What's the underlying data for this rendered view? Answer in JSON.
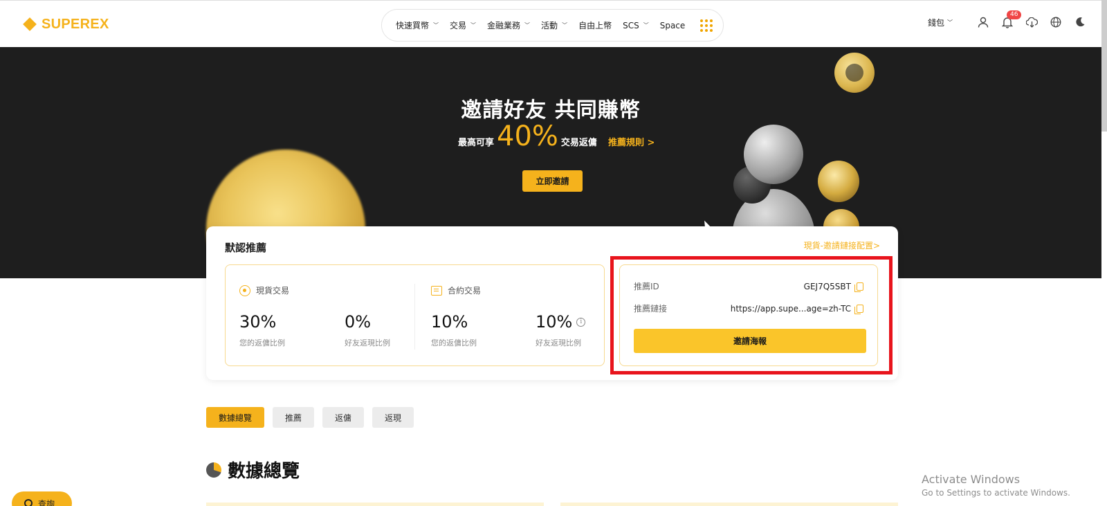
{
  "header": {
    "logo_text": "SUPEREX",
    "nav": [
      {
        "label": "快速買幣",
        "dropdown": true
      },
      {
        "label": "交易",
        "dropdown": true
      },
      {
        "label": "金融業務",
        "dropdown": true
      },
      {
        "label": "活動",
        "dropdown": true
      },
      {
        "label": "自由上幣",
        "dropdown": false
      },
      {
        "label": "SCS",
        "dropdown": true
      },
      {
        "label": "Space",
        "dropdown": false
      }
    ],
    "wallet_label": "錢包",
    "notification_count": "46",
    "icons": [
      "user-icon",
      "bell-icon",
      "download-icon",
      "globe-icon",
      "moon-icon"
    ]
  },
  "hero": {
    "title": "邀請好友 共同賺幣",
    "sub_prefix": "最高可享",
    "sub_percent": "40%",
    "sub_suffix": "交易返傭",
    "rules_link": "推薦規則 >",
    "invite_button": "立即邀請"
  },
  "referral": {
    "title": "默認推薦",
    "config_link": "現貨-邀請鏈接配置>",
    "spot": {
      "label": "現貨交易",
      "your_rate": "30%",
      "your_rate_label": "您的返傭比例",
      "friend_rate": "0%",
      "friend_rate_label": "好友返現比例"
    },
    "futures": {
      "label": "合約交易",
      "your_rate": "10%",
      "your_rate_label": "您的返傭比例",
      "friend_rate": "10%",
      "friend_rate_label": "好友返現比例"
    },
    "id_label": "推薦ID",
    "id_value": "GEJ7Q5SBT",
    "link_label": "推薦鏈接",
    "link_value": "https://app.supe...age=zh-TC",
    "poster_button": "邀請海報"
  },
  "tabs": [
    {
      "label": "數據總覽",
      "active": true
    },
    {
      "label": "推薦",
      "active": false
    },
    {
      "label": "返傭",
      "active": false
    },
    {
      "label": "返現",
      "active": false
    }
  ],
  "section_title": "數據總覽",
  "support_label": "查詢",
  "watermark": {
    "line1": "Activate Windows",
    "line2": "Go to Settings to activate Windows."
  },
  "colors": {
    "accent": "#f5b21c",
    "hero_bg": "#1e1e1e",
    "highlight_frame": "#e8141c"
  }
}
